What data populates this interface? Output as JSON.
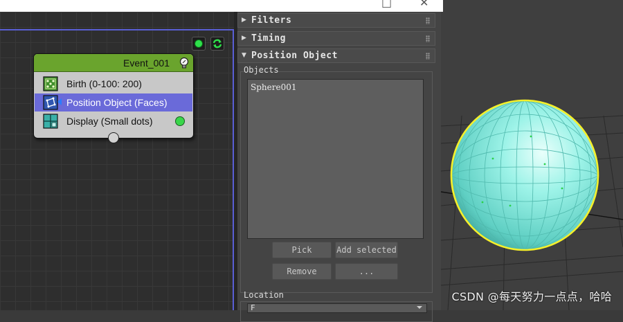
{
  "window": {
    "minimize_glyph": "□",
    "close_glyph": "✕"
  },
  "particle_view": {
    "toolbar": {
      "activate_icon": "green-dot-icon",
      "refresh_icon": "refresh-icon"
    },
    "event_node": {
      "title": "Event_001",
      "header_color": "#6aa42d",
      "operators": [
        {
          "label": "Birth (0-100: 200)",
          "icon": "birth-icon"
        },
        {
          "label": "Position Object (Faces)",
          "icon": "position-object-icon",
          "selected": true
        },
        {
          "label": "Display (Small dots)",
          "icon": "display-icon"
        }
      ]
    }
  },
  "command_panel": {
    "rollouts": [
      {
        "title": "Filters",
        "expanded": false
      },
      {
        "title": "Timing",
        "expanded": false
      },
      {
        "title": "Position Object",
        "expanded": true
      }
    ],
    "objects": {
      "label": "Objects",
      "items": [
        "Sphere001"
      ],
      "buttons": {
        "pick": "Pick",
        "add_selected": "Add selected",
        "remove": "Remove",
        "more": "..."
      }
    },
    "location": {
      "label": "Location",
      "value": "F"
    }
  },
  "viewport": {
    "object_color": "#7fe8dc",
    "selection_color": "#f5f02a"
  },
  "watermark": "CSDN @每天努力一点点，哈哈"
}
